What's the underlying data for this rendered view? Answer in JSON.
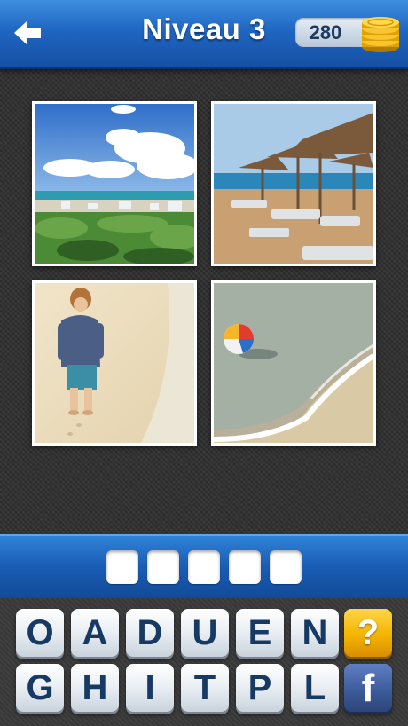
{
  "header": {
    "back_icon": "back-arrow-icon",
    "title": "Niveau 3",
    "coins": "280",
    "coin_icon": "gold-coins-icon"
  },
  "photos": [
    {
      "name": "photo-beach-dunes"
    },
    {
      "name": "photo-beach-umbrellas"
    },
    {
      "name": "photo-child-on-sand"
    },
    {
      "name": "photo-beach-ball-wave"
    }
  ],
  "answer": {
    "slot_count": 5,
    "slots": [
      "",
      "",
      "",
      "",
      ""
    ]
  },
  "keyboard": {
    "row1": [
      "O",
      "A",
      "D",
      "U",
      "E",
      "N"
    ],
    "row2": [
      "G",
      "H",
      "I",
      "T",
      "P",
      "L"
    ],
    "hint_label": "?",
    "facebook_label": "f"
  },
  "colors": {
    "header_blue": "#1f66c2",
    "key_text": "#173a64",
    "hint_gold": "#f4b400",
    "facebook_blue": "#3b5998"
  }
}
